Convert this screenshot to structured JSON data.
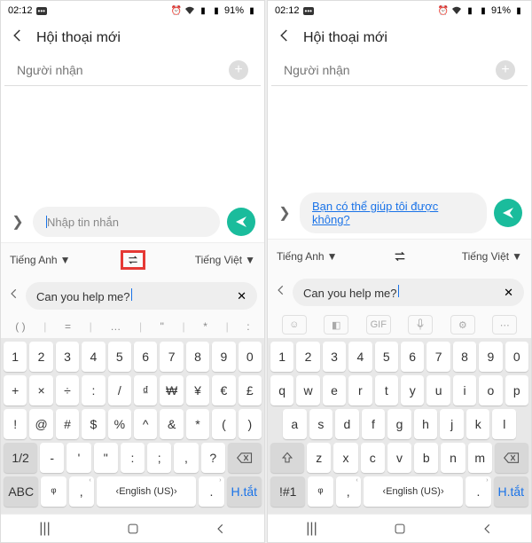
{
  "status": {
    "time": "02:12",
    "battery": "91%"
  },
  "header": {
    "title": "Hội thoại mới"
  },
  "recipient": {
    "placeholder": "Người nhận"
  },
  "message": {
    "placeholder": "Nhập tin nhắn",
    "translated": "Bạn có thể giúp tôi được không?"
  },
  "translate": {
    "source": "Tiếng Anh",
    "target": "Tiếng Việt",
    "input": "Can you help me?"
  },
  "suggest_sym": {
    "a": "( )",
    "b": "=",
    "c": "…",
    "d": "\"",
    "e": "*",
    "f": ":"
  },
  "keys": {
    "row1": [
      "1",
      "2",
      "3",
      "4",
      "5",
      "6",
      "7",
      "8",
      "9",
      "0"
    ],
    "sym2": [
      "+",
      "×",
      "÷",
      ":",
      "/",
      "₫",
      "₩",
      "¥",
      "€",
      "£"
    ],
    "sym3": [
      "!",
      "@",
      "#",
      "$",
      "%",
      "^",
      "&",
      "*",
      "(",
      ")"
    ],
    "sym4": [
      "-",
      "'",
      "\"",
      ":",
      ";",
      ",",
      "?"
    ],
    "q2": [
      "q",
      "w",
      "e",
      "r",
      "t",
      "y",
      "u",
      "i",
      "o",
      "p"
    ],
    "q3": [
      "a",
      "s",
      "d",
      "f",
      "g",
      "h",
      "j",
      "k",
      "l"
    ],
    "q4": [
      "z",
      "x",
      "c",
      "v",
      "b",
      "n",
      "m"
    ],
    "half": "1/2",
    "abc": "ABC",
    "numsym": "!#1",
    "space": "English (US)",
    "htat": "H.tắt",
    "comma": ",",
    "q": "ᵠ",
    "dot": "."
  }
}
